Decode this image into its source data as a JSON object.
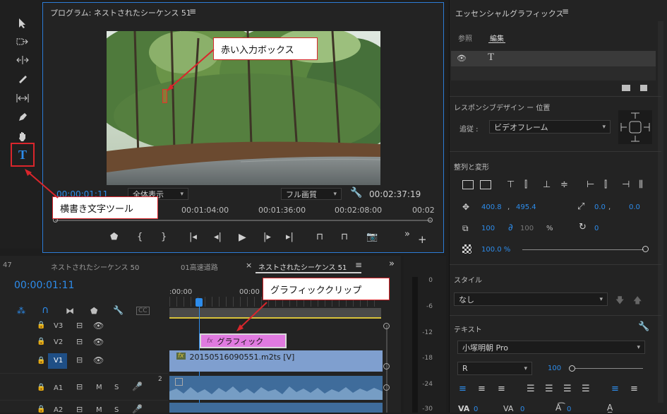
{
  "program_monitor": {
    "title": "プログラム: ネストされたシーケンス 51",
    "menu_icon": "hamburger-icon",
    "timecode_current": "00:00:01:11",
    "fit_select": "全体表示",
    "quality_select": "フル画質",
    "timecode_total": "00:02:37:19",
    "ruler_ticks": [
      "00:01:04:00",
      "00:01:36:00",
      "00:02:08:00",
      "00:02"
    ]
  },
  "tools": [
    "select-icon",
    "track-select-icon",
    "ripple-edit-icon",
    "razor-icon",
    "slip-icon",
    "pen-icon",
    "hand-icon",
    "type-tool-icon"
  ],
  "callouts": {
    "red_box": "赤い入力ボックス",
    "type_tool": "横書き文字ツール",
    "graphic_clip": "グラフィッククリップ"
  },
  "timeline": {
    "tabs": [
      {
        "label": "47"
      },
      {
        "label": "ネストされたシーケンス 50"
      },
      {
        "label": "01高速道路"
      },
      {
        "label": "ネストされたシーケンス 51",
        "active": true
      }
    ],
    "close_glyph": "×",
    "timecode": "00:00:01:11",
    "ruler_ticks": [
      ":00:00",
      "00:00"
    ],
    "tracks": [
      {
        "id": "V3"
      },
      {
        "id": "V2"
      },
      {
        "id": "V1"
      },
      {
        "id": "A1",
        "m": "M",
        "s": "S"
      },
      {
        "id": "A2",
        "m": "M",
        "s": "S"
      }
    ],
    "graphic_clip": "グラフィック",
    "video_clip": "20150516090551.m2ts [V]",
    "fx": "fx",
    "audio_channel": "2"
  },
  "meter": {
    "ticks": [
      "0",
      "-6",
      "-12",
      "-18",
      "-24",
      "-30"
    ]
  },
  "essential_graphics": {
    "title": "エッセンシャルグラフィックス",
    "tabs": [
      "参照",
      "編集"
    ],
    "active_tab": "編集",
    "responsive_design": "レスポンシブデザイン ー 位置",
    "follow_label": "追従 :",
    "follow_value": "ビデオフレーム",
    "align_transform": "整列と変形",
    "position_x": "400.8",
    "position_y": "495.4",
    "comma": ",",
    "anchor_x": "0.0",
    "anchor_y": "0.0",
    "scale": "100",
    "scale_locked": "100",
    "percent": "%",
    "rotation": "0",
    "opacity": "100.0 %",
    "style_label": "スタイル",
    "style_value": "なし",
    "text_label": "テキスト",
    "font_family": "小塚明朝 Pro",
    "font_style": "R",
    "font_size": "100",
    "va_labels": [
      "VA",
      "0",
      "VA",
      "0",
      "0"
    ]
  },
  "colors": {
    "accent_blue": "#2d8ceb",
    "callout_red": "#d9262c",
    "graphic_clip": "#e07ae0",
    "video_clip": "#7f9fcf",
    "audio_clip": "#3f6c9b",
    "playhead": "#2d8ceb",
    "work_area": "#d8c23a"
  }
}
